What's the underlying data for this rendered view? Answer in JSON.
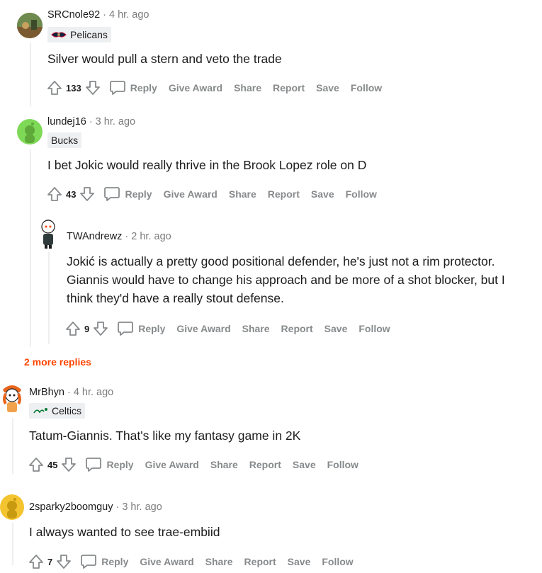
{
  "comments": [
    {
      "username": "SRCnole92",
      "time": "4 hr. ago",
      "flair": "Pelicans",
      "body": "Silver would pull a stern and veto the trade",
      "score": "133"
    },
    {
      "username": "lundej16",
      "time": "3 hr. ago",
      "flair": "Bucks",
      "body": "I bet Jokic would really thrive in the Brook Lopez role on D",
      "score": "43"
    },
    {
      "username": "TWAndrewz",
      "time": "2 hr. ago",
      "body": "Jokić is actually a pretty good positional defender, he's just not a rim protector. Giannis would have to change his approach and be more of a shot blocker, but I think they'd have a really stout defense.",
      "score": "9"
    },
    {
      "username": "MrBhyn",
      "time": "4 hr. ago",
      "flair": "Celtics",
      "body": "Tatum-Giannis. That's like my fantasy game in 2K",
      "score": "45"
    },
    {
      "username": "2sparky2boomguy",
      "time": "3 hr. ago",
      "body": "I always wanted to see trae-embiid",
      "score": "7"
    }
  ],
  "actions": {
    "reply": "Reply",
    "give_award": "Give Award",
    "share": "Share",
    "report": "Report",
    "save": "Save",
    "follow": "Follow"
  },
  "more_replies": "2 more replies",
  "separator": "·",
  "colors": {
    "accent": "#ff4500",
    "muted": "#878a8c",
    "avatar_green": "#7ed957",
    "avatar_yellow": "#f4c430"
  }
}
